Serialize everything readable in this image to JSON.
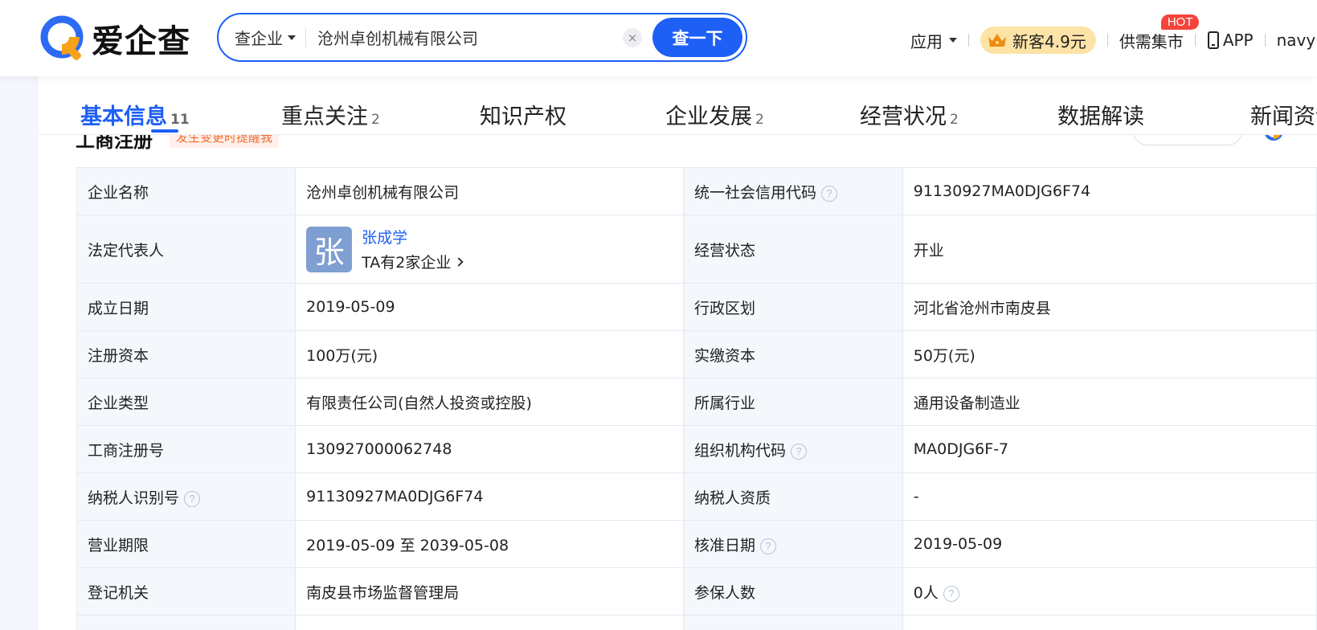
{
  "header": {
    "logo_text": "爱企查",
    "search": {
      "type_label": "查企业",
      "query": "沧州卓创机械有限公司",
      "clear_glyph": "×",
      "button_label": "查一下"
    },
    "nav": {
      "apps_label": "应用",
      "promo_label": "新客4.9元",
      "supply_label": "供需集市",
      "hot_badge": "HOT",
      "app_label": "APP",
      "user_label": "navy"
    }
  },
  "tabs": [
    {
      "label": "基本信息",
      "count": "11"
    },
    {
      "label": "重点关注",
      "count": "2"
    },
    {
      "label": "知识产权",
      "count": ""
    },
    {
      "label": "企业发展",
      "count": "2"
    },
    {
      "label": "经营状况",
      "count": "2"
    },
    {
      "label": "数据解读",
      "count": ""
    },
    {
      "label": "新闻资讯",
      "count": ""
    }
  ],
  "section": {
    "title": "工商注册",
    "notify": "发生变更时提醒我"
  },
  "info": {
    "company_name": {
      "key": "企业名称",
      "value": "沧州卓创机械有限公司"
    },
    "credit_code": {
      "key": "统一社会信用代码",
      "value": "91130927MA0DJG6F74"
    },
    "legal_rep": {
      "key": "法定代表人",
      "avatar": "张",
      "name": "张成学",
      "companies": "TA有2家企业"
    },
    "status": {
      "key": "经营状态",
      "value": "开业"
    },
    "founded": {
      "key": "成立日期",
      "value": "2019-05-09"
    },
    "region": {
      "key": "行政区划",
      "value": "河北省沧州市南皮县"
    },
    "reg_capital": {
      "key": "注册资本",
      "value": "100万(元)"
    },
    "paid_capital": {
      "key": "实缴资本",
      "value": "50万(元)"
    },
    "company_type": {
      "key": "企业类型",
      "value": "有限责任公司(自然人投资或控股)"
    },
    "industry": {
      "key": "所属行业",
      "value": "通用设备制造业"
    },
    "reg_number": {
      "key": "工商注册号",
      "value": "130927000062748"
    },
    "org_code": {
      "key": "组织机构代码",
      "value": "MA0DJG6F-7"
    },
    "taxpayer_id": {
      "key": "纳税人识别号",
      "value": "91130927MA0DJG6F74"
    },
    "taxpayer_qual": {
      "key": "纳税人资质",
      "value": "-"
    },
    "term": {
      "key": "营业期限",
      "value": "2019-05-09 至 2039-05-08"
    },
    "approval_date": {
      "key": "核准日期",
      "value": "2019-05-09"
    },
    "authority": {
      "key": "登记机关",
      "value": "南皮县市场监督管理局"
    },
    "insured": {
      "key": "参保人数",
      "value": "0人"
    }
  },
  "help_glyph": "?",
  "colors": {
    "brand_blue": "#1e5ff5",
    "logo_orange": "#f7a21b",
    "key_cell_bg": "#f4f7fc",
    "hot_red": "#f5443b",
    "promo_bg": "#fde3a6"
  }
}
